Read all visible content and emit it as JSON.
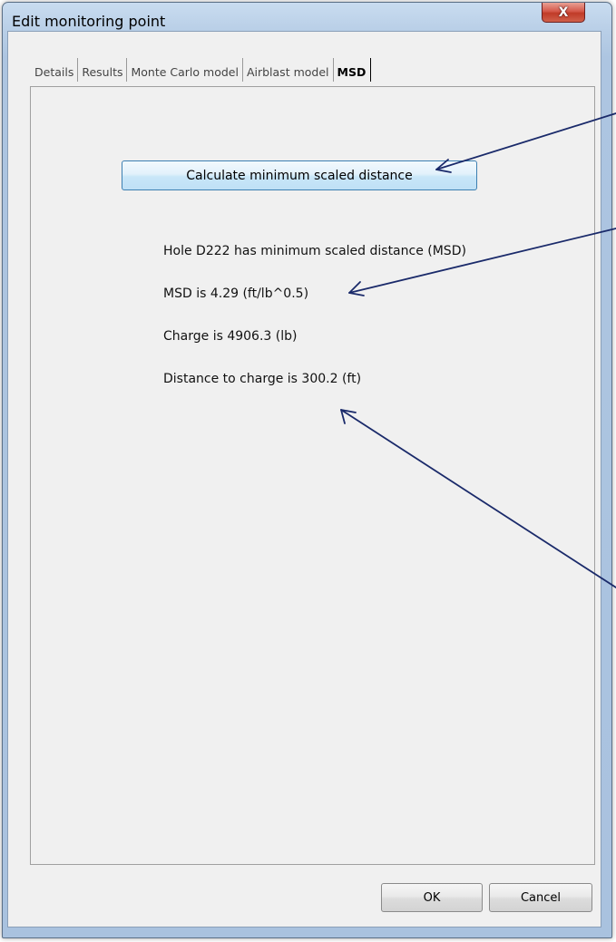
{
  "window": {
    "title": "Edit monitoring point",
    "close_label": "X"
  },
  "tabs": [
    {
      "label": "Details",
      "active": false
    },
    {
      "label": "Results",
      "active": false
    },
    {
      "label": "Monte Carlo model",
      "active": false
    },
    {
      "label": "Airblast model",
      "active": false
    },
    {
      "label": "MSD",
      "active": true
    }
  ],
  "msd": {
    "calculate_label": "Calculate minimum scaled distance",
    "hole_text": "Hole D222 has minimum scaled distance (MSD)",
    "msd_text": "MSD is 4.29 (ft/lb^0.5)",
    "charge_text": "Charge is 4906.3 (lb)",
    "distance_text": "Distance to charge is 300.2 (ft)"
  },
  "footer": {
    "ok_label": "OK",
    "cancel_label": "Cancel"
  },
  "annotation_color": "#1a2a6a"
}
